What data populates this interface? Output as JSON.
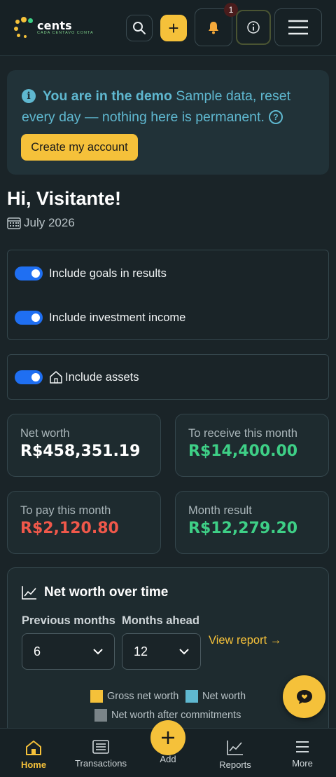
{
  "header": {
    "logo_name": "cents",
    "logo_tagline": "CADA CENTAVO CONTA",
    "notification_count": "1",
    "add_label": "+"
  },
  "demo_banner": {
    "title": "You are in the demo",
    "message": "Sample data, reset every day — nothing here is permanent.",
    "button_label": "Create my account"
  },
  "greeting": "Hi, Visitante!",
  "current_month": "July 2026",
  "toggles": [
    {
      "label": "Include goals in results",
      "on": true
    },
    {
      "label": "Include investment income",
      "on": true
    },
    {
      "label": "Include assets",
      "on": true
    }
  ],
  "stats": {
    "net_worth": {
      "label": "Net worth",
      "value": "R$458,351.19",
      "color": "#ffffff"
    },
    "to_receive": {
      "label": "To receive this month",
      "value": "R$14,400.00",
      "color": "#3ecf86"
    },
    "to_pay": {
      "label": "To pay this month",
      "value": "R$2,120.80",
      "color": "#f0584a"
    },
    "month_result": {
      "label": "Month result",
      "value": "R$12,279.20",
      "color": "#3ecf86"
    }
  },
  "chart_card": {
    "title": "Net worth over time",
    "previous_months_label": "Previous months",
    "previous_months_value": "6",
    "months_ahead_label": "Months ahead",
    "months_ahead_value": "12",
    "view_report": "View report →",
    "legend": [
      {
        "label": "Gross net worth",
        "color": "#f5c13a"
      },
      {
        "label": "Net worth",
        "color": "#5fb8d0"
      },
      {
        "label": "Net worth after commitments",
        "color": "#7a8488"
      }
    ]
  },
  "bottom_nav": {
    "home": "Home",
    "transactions": "Transactions",
    "add": "Add",
    "reports": "Reports",
    "more": "More"
  },
  "colors": {
    "accent": "#f5c13a",
    "background": "#1a2428",
    "info": "#5fb8d0",
    "toggle": "#1f6ff2"
  }
}
